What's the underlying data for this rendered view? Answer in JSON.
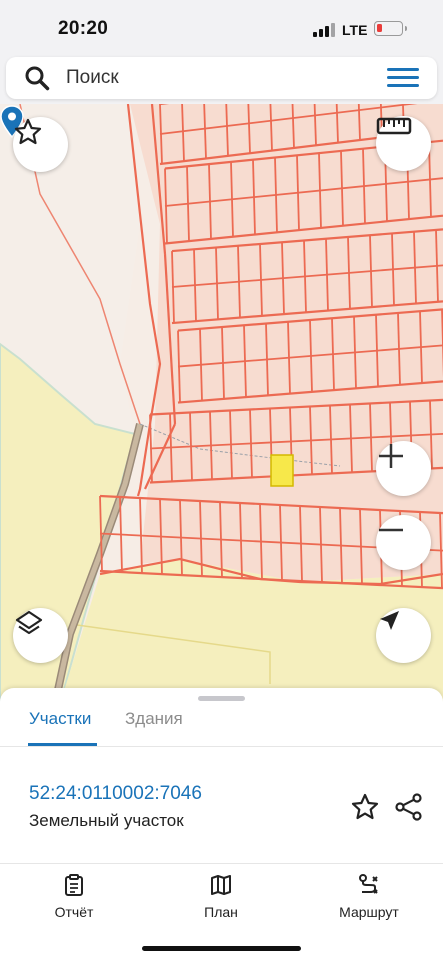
{
  "status_bar": {
    "time": "20:20",
    "network": "LTE"
  },
  "search": {
    "placeholder": "Поиск"
  },
  "icons": {
    "search": "search-icon",
    "menu": "menu-icon",
    "favorite": "star-icon",
    "ruler": "ruler-icon",
    "zoom_in": "plus-icon",
    "zoom_out": "minus-icon",
    "layers": "layers-icon",
    "locate": "navigation-arrow-icon",
    "pin": "location-pin-icon",
    "report": "clipboard-icon",
    "plan": "map-icon",
    "route": "route-icon",
    "share": "share-icon"
  },
  "colors": {
    "accent": "#1a73b8",
    "parcel_line": "#ec6a52",
    "parcel_fill": "#f7d8cc",
    "field_yellow": "#f5efb8",
    "pin_blue": "#1a73b8",
    "selected_parcel": "#f7e84a"
  },
  "sheet": {
    "tabs": [
      {
        "label": "Участки",
        "active": true
      },
      {
        "label": "Здания",
        "active": false
      }
    ],
    "parcel": {
      "cadastral_number": "52:24:0110002:7046",
      "type": "Земельный участок"
    }
  },
  "bottom_nav": {
    "items": [
      {
        "label": "Отчёт"
      },
      {
        "label": "План"
      },
      {
        "label": "Маршрут"
      }
    ]
  }
}
